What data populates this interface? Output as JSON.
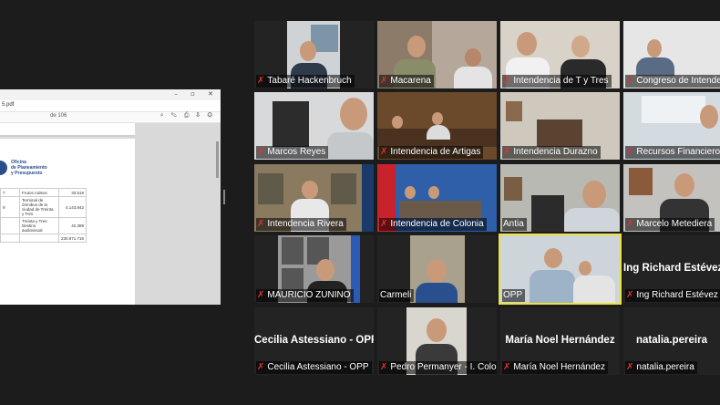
{
  "shared_screen": {
    "filename": "5.pdf",
    "window_controls": "–  ▫  ✕",
    "toolbar_text": "de 106",
    "logo_lines": [
      "Oficina",
      "de Planeamiento",
      "y Presupuesto"
    ],
    "table_rows": [
      [
        "7",
        "Frutos rodeos",
        "33.519"
      ],
      [
        "9",
        "Terminal de ómnibus de la ciudad de Treinta y Tres",
        "4.143.842"
      ],
      [
        "",
        "Treinta y Tres: Destino audiovisual",
        "42.389"
      ],
      [
        "",
        "",
        "230.871.716"
      ]
    ]
  },
  "participants": [
    {
      "name": "Tabaré Hackenbruch",
      "muted": true
    },
    {
      "name": "Macarena",
      "muted": true
    },
    {
      "name": "Intendencia de T y Tres",
      "muted": true
    },
    {
      "name": "Congreso de Intendentes",
      "muted": true
    },
    {
      "name": "Marcos Reyes",
      "muted": true
    },
    {
      "name": "Intendencia de Artigas",
      "muted": true
    },
    {
      "name": "Intendencia Durazno",
      "muted": true
    },
    {
      "name": "Recursos Financieros",
      "muted": true
    },
    {
      "name": "Intendencia Rivera",
      "muted": true
    },
    {
      "name": "Intendencia de Colonia",
      "muted": true
    },
    {
      "name": "Antia",
      "muted": false
    },
    {
      "name": "Marcelo Metediera",
      "muted": true
    },
    {
      "name": "MAURICIO ZUNINO",
      "muted": true
    },
    {
      "name": "Carmeli",
      "muted": false
    },
    {
      "name": "OPP",
      "muted": false,
      "active_speaker": true
    },
    {
      "name": "Ing Richard Estévez",
      "muted": true,
      "big_label": "Ing Richard Estévez"
    },
    {
      "name": "Cecilia Astessiano - OPP",
      "muted": true,
      "big_label": "Cecilia Astessiano - OPP"
    },
    {
      "name": "Pedro Permanyer - I. Colonia",
      "muted": true
    },
    {
      "name": "María Noel Hernández",
      "muted": true,
      "big_label": "María Noel Hernández"
    },
    {
      "name": "natalia.pereira",
      "muted": true,
      "big_label": "natalia.pereira"
    }
  ],
  "icons": {
    "muted": "mic-muted-icon"
  },
  "colors": {
    "active_speaker_border": "#e9e33b",
    "muted_icon": "#e0312c",
    "background": "#1c1c1c"
  }
}
